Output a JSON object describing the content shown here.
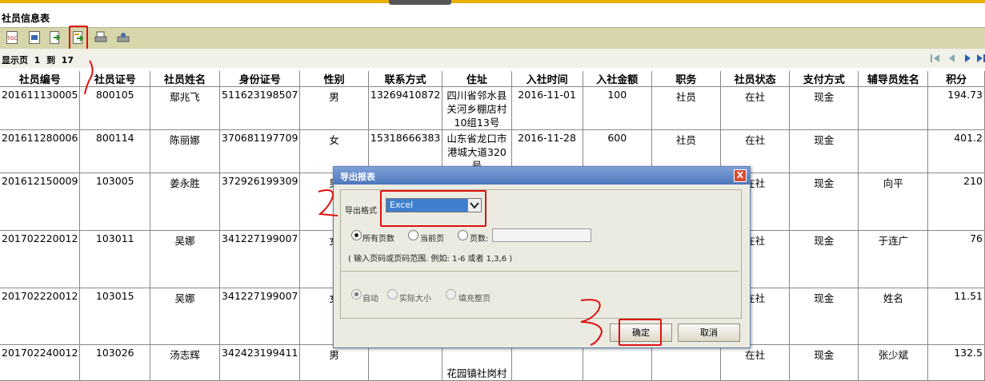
{
  "report_title": "社员信息表",
  "pager": {
    "prefix": "显示页",
    "from": "1",
    "to_label": "到",
    "to": "17"
  },
  "toolbar": {
    "icons": [
      "toc-icon",
      "pdf-icon",
      "export-green-icon",
      "export-report-icon",
      "print-icon",
      "settings-print-icon"
    ]
  },
  "table": {
    "headers": [
      "社员编号",
      "社员证号",
      "社员姓名",
      "身份证号",
      "性别",
      "联系方式",
      "住址",
      "入社时间",
      "入社金额",
      "职务",
      "社员状态",
      "支付方式",
      "辅导员姓名",
      "积分"
    ],
    "rows": [
      [
        "201611130005",
        "800105",
        "鄢兆飞",
        "511623198507",
        "男",
        "13269410872",
        "四川省邻水县关河乡棚店村10组13号",
        "2016-11-01",
        "100",
        "社员",
        "在社",
        "现金",
        "",
        "194.73"
      ],
      [
        "201611280006",
        "800114",
        "陈丽娜",
        "370681197709",
        "女",
        "15318666383",
        "山东省龙口市港城大道320号",
        "2016-11-28",
        "600",
        "社员",
        "在社",
        "现金",
        "",
        "401.2"
      ],
      [
        "201612150009",
        "103005",
        "姜永胜",
        "372926199309",
        "男",
        "",
        "",
        "",
        "",
        "",
        "在社",
        "现金",
        "向平",
        "210"
      ],
      [
        "201702220012",
        "103011",
        "吴娜",
        "341227199007",
        "女",
        "",
        "",
        "",
        "",
        "",
        "在社",
        "现金",
        "于连广",
        "76"
      ],
      [
        "201702220012",
        "103015",
        "吴娜",
        "341227199007",
        "女",
        "",
        "",
        "",
        "",
        "",
        "在社",
        "现金",
        "姓名",
        "11.51"
      ],
      [
        "201702240012",
        "103026",
        "汤志辉",
        "342423199411",
        "男",
        "",
        "花园镇社岗村",
        "",
        "",
        "",
        "在社",
        "现金",
        "张少斌",
        "132.5"
      ]
    ]
  },
  "dialog": {
    "title": "导出报表",
    "close": "X",
    "format_label": "导出格式",
    "format_value": "Excel",
    "all_pages": "所有页数",
    "current_page": "当前页",
    "pages": "页数:",
    "hint": "( 输入页码或页码范围. 例如: 1-6 或者  1,3,6 )",
    "auto": "自动",
    "actual_size": "实际大小",
    "fill_page": "填充整页",
    "ok": "确定",
    "cancel": "取消"
  },
  "annotations": {
    "ink_color": "#e01010"
  }
}
